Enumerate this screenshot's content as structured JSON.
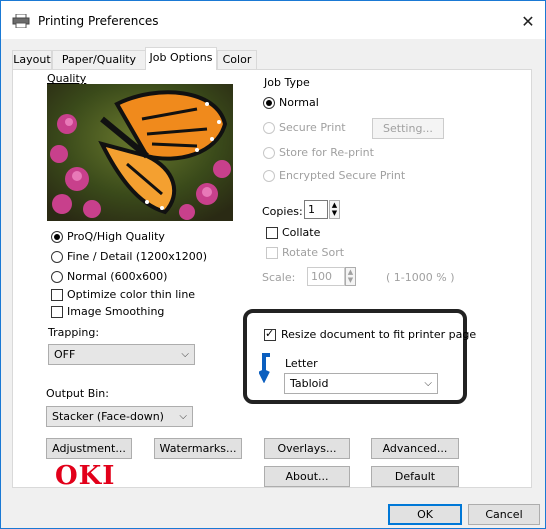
{
  "window": {
    "title": "Printing Preferences",
    "close_glyph": "✕"
  },
  "tabs": [
    "Layout",
    "Paper/Quality",
    "Job Options",
    "Color"
  ],
  "quality": {
    "group_label": "Quality",
    "options": [
      "ProQ/High Quality",
      "Fine / Detail (1200x1200)",
      "Normal (600x600)"
    ],
    "selected": "ProQ/High Quality",
    "checkboxes": [
      "Optimize color thin line",
      "Image Smoothing"
    ]
  },
  "trapping": {
    "label": "Trapping:",
    "value": "OFF"
  },
  "job_type": {
    "group_label": "Job Type",
    "options": [
      "Normal",
      "Secure Print",
      "Store for Re-print",
      "Encrypted Secure Print"
    ],
    "selected": "Normal",
    "setting_button": "Setting..."
  },
  "copies": {
    "label": "Copies:",
    "value": "1",
    "collate_label": "Collate",
    "rotate_sort_label": "Rotate Sort"
  },
  "scale": {
    "label": "Scale:",
    "value": "100",
    "range": "( 1-1000 % )"
  },
  "resize": {
    "checkbox_label": "Resize document to fit printer page",
    "source_paper": "Letter",
    "target_paper": "Tabloid"
  },
  "output_bin": {
    "label": "Output Bin:",
    "value": "Stacker (Face-down)"
  },
  "buttons": {
    "adjustment": "Adjustment...",
    "watermarks": "Watermarks...",
    "overlays": "Overlays...",
    "advanced": "Advanced...",
    "about": "About...",
    "default": "Default",
    "ok": "OK",
    "cancel": "Cancel"
  },
  "brand": {
    "logo_text": "OKI",
    "color": "#e2001a"
  },
  "colors": {
    "accent": "#0078d7",
    "highlight_frame": "#222222"
  }
}
